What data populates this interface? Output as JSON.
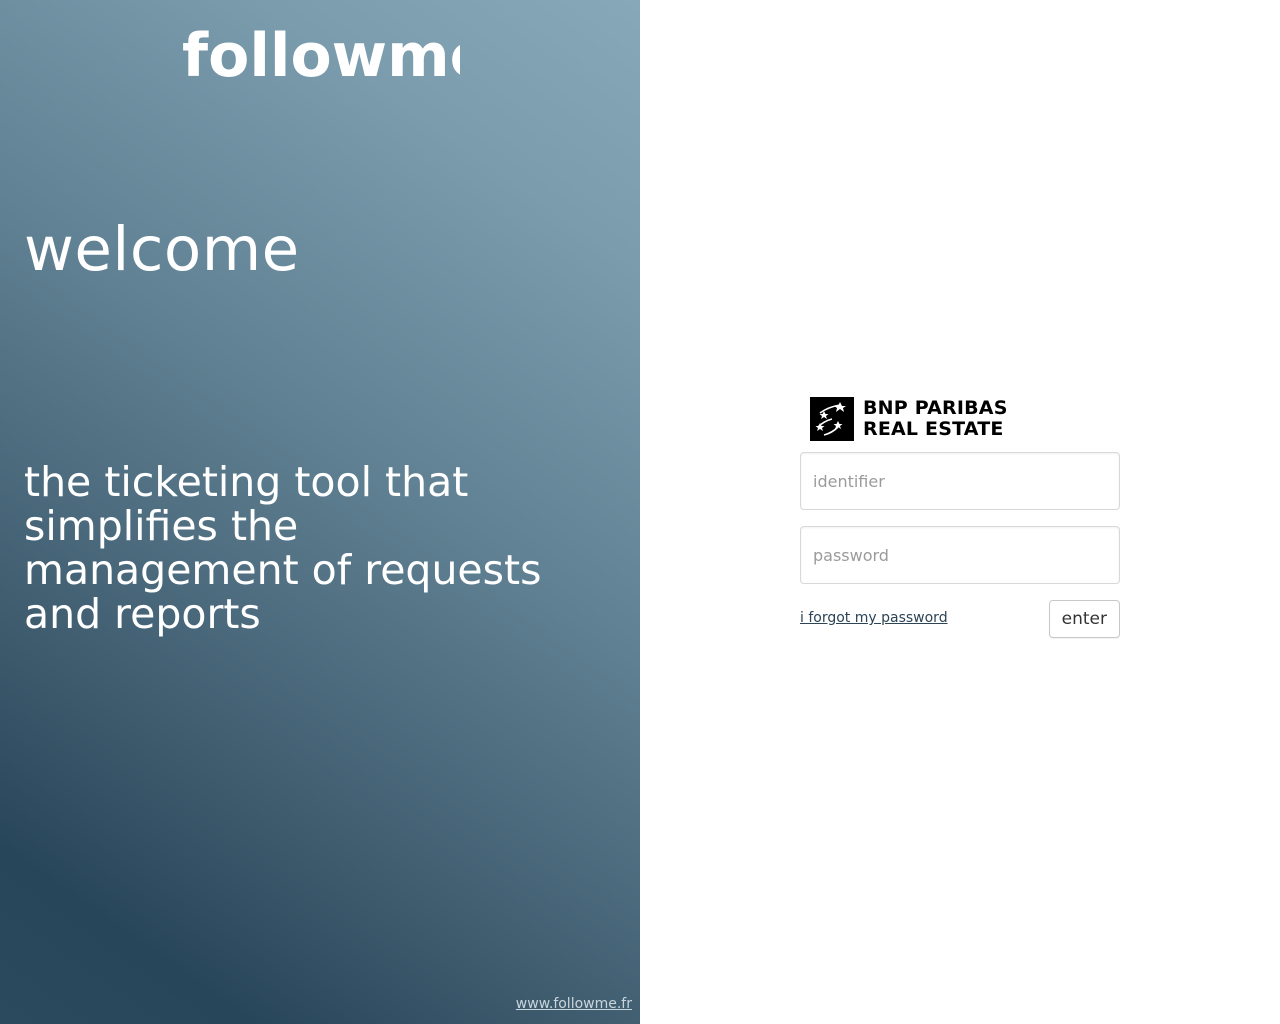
{
  "brand": {
    "logo_text": "followme"
  },
  "hero": {
    "welcome": "welcome",
    "tagline": "the ticketing tool that simplifies the management of requests and reports"
  },
  "footer": {
    "link_text": "www.followme.fr"
  },
  "company": {
    "name_line1": "BNP PARIBAS",
    "name_line2": "REAL ESTATE",
    "emblem_icon": "bnp-stars-icon"
  },
  "login": {
    "identifier_placeholder": "identifier",
    "identifier_value": "",
    "password_placeholder": "password",
    "password_value": "",
    "forgot_label": "i forgot my password",
    "enter_label": "enter"
  },
  "colors": {
    "panel_light": "#86a8b8",
    "panel_dark": "#28465a",
    "link": "#2c4456"
  }
}
